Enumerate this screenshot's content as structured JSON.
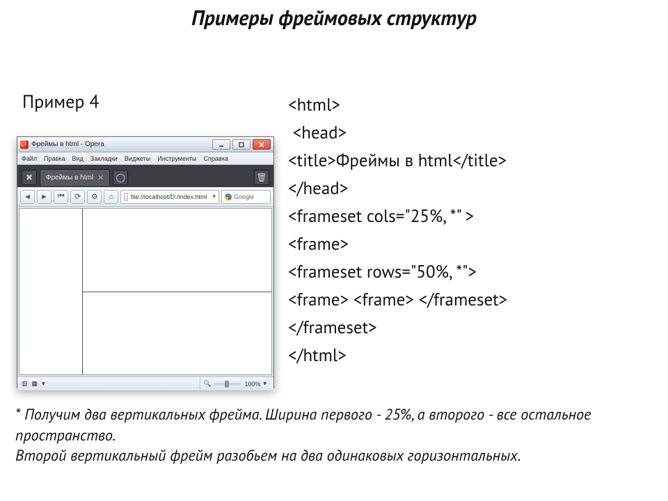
{
  "slide_title": "Примеры фреймовых структур",
  "example_label": "Пример 4",
  "code_lines": [
    "<html>",
    " <head>",
    "<title>Фреймы в html</title>",
    "</head>",
    "<frameset cols=\"25%, *\" >",
    "<frame>",
    "<frameset rows=\"50%, *\">",
    "<frame> <frame> </frameset>",
    "</frameset>",
    "</html>"
  ],
  "footnote": {
    "line1": "* Получим два вертикальных фрейма. Ширина первого - 25%, а второго - все остальное пространство.",
    "line2": "Второй вертикальный фрейм разобьем на два одинаковых горизонтальных."
  },
  "browser": {
    "window_title": "Фреймы в html - Opera",
    "menus": [
      "Файл",
      "Правка",
      "Вид",
      "Закладки",
      "Виджеты",
      "Инструменты",
      "Справка"
    ],
    "tab_label": "Фреймы в html",
    "address": "file://localhost/D:/index.html",
    "search_placeholder": "Google",
    "status": {
      "views_icon": "▦",
      "zoom_label": "100%"
    }
  }
}
